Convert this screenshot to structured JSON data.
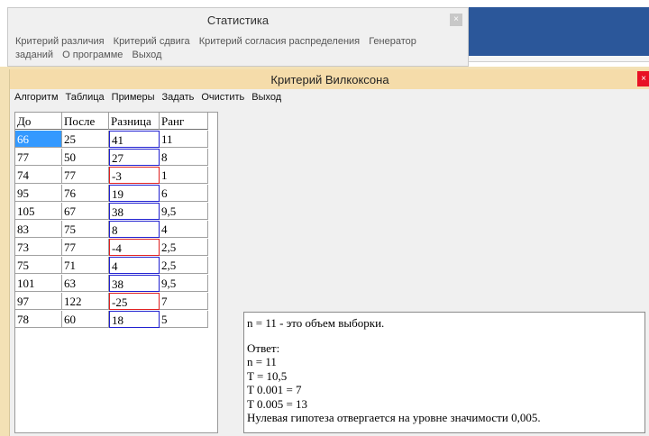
{
  "background_window": {
    "title": "Статистика",
    "close_glyph": "×",
    "menu": [
      "Критерий различия",
      "Критерий сдвига",
      "Критерий согласия распределения",
      "Генератор заданий",
      "О программе",
      "Выход"
    ]
  },
  "window": {
    "title": "Критерий Вилкоксона",
    "close_glyph": "×"
  },
  "menu": [
    "Алгоритм",
    "Таблица",
    "Примеры",
    "Задать",
    "Очистить",
    "Выход"
  ],
  "table": {
    "headers": [
      "До",
      "После",
      "Разница",
      "Ранг"
    ],
    "rows": [
      [
        "66",
        "25",
        "41",
        "11"
      ],
      [
        "77",
        "50",
        "27",
        "8"
      ],
      [
        "74",
        "77",
        "-3",
        "1"
      ],
      [
        "95",
        "76",
        "19",
        "6"
      ],
      [
        "105",
        "67",
        "38",
        "9,5"
      ],
      [
        "83",
        "75",
        "8",
        "4"
      ],
      [
        "73",
        "77",
        "-4",
        "2,5"
      ],
      [
        "75",
        "71",
        "4",
        "2,5"
      ],
      [
        "101",
        "63",
        "38",
        "9,5"
      ],
      [
        "97",
        "122",
        "-25",
        "7"
      ],
      [
        "78",
        "60",
        "18",
        "5"
      ]
    ]
  },
  "output": {
    "line1": "n = 11 - это объем выборки.",
    "answer_label": "Ответ:",
    "n": "n = 11",
    "t": "T = 10,5",
    "t001": "T 0.001 = 7",
    "t005": "T 0.005 = 13",
    "conclusion": "Нулевая гипотеза отвергается на уровне значимости 0,005."
  },
  "colors": {
    "title_bar": "#f5dcaa",
    "close_button": "#e81123",
    "selection": "#3399ff",
    "positive_border": "#2020d0",
    "negative_border": "#e02020",
    "accent_band": "#2b579a"
  }
}
